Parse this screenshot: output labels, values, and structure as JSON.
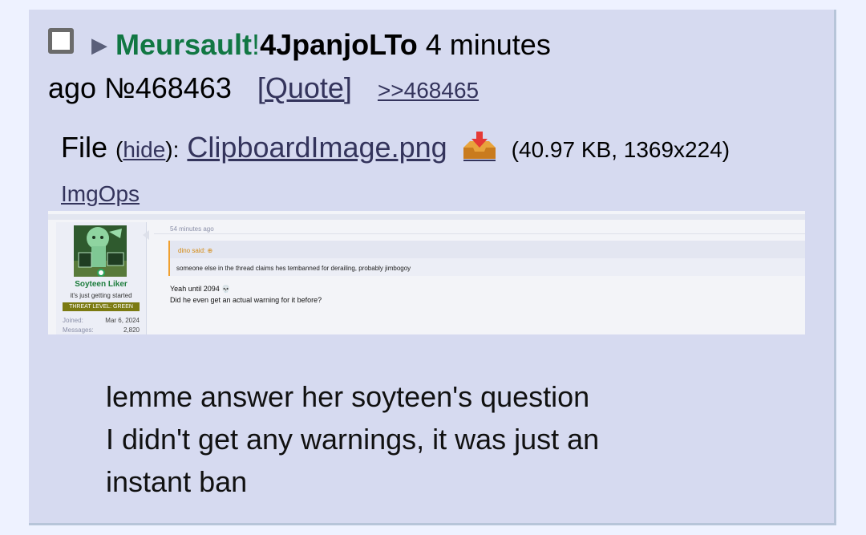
{
  "post": {
    "name": "Meursault",
    "trip_separator": "!",
    "tripcode": "4JpanjoLTo",
    "time_top": "4 minutes",
    "time_bottom": "ago",
    "post_number": "№468463",
    "quote_label": "[Quote]",
    "backlink": ">>468465",
    "file_label": "File",
    "hide_label": "hide",
    "filename": "ClipboardImage.png",
    "file_meta": "(40.97 KB, 1369x224)",
    "imgops": "ImgOps",
    "comment_lines": [
      "lemme answer her soyteen's question",
      "I didn't get any warnings, it was just an",
      "instant ban"
    ]
  },
  "screenshot": {
    "username": "Soyteen Liker",
    "user_title": "it's just getting started",
    "threat_level": "THREAT LEVEL: GREEN",
    "joined_label": "Joined:",
    "joined_value": "Mar 6, 2024",
    "messages_label": "Messages:",
    "messages_value": "2,820",
    "time_ago": "54 minutes ago",
    "quote_author": "dino said: ⊕",
    "quote_text": "someone else in the thread claims hes tembanned for derailing, probably jimbogoy",
    "reply_line1": "Yeah until 2094 💀",
    "reply_line2": "Did he even get an actual warning for it before?"
  },
  "colors": {
    "post_bg": "#d6daf0",
    "page_bg": "#eef2ff",
    "name": "#117743",
    "link": "#34345c"
  }
}
